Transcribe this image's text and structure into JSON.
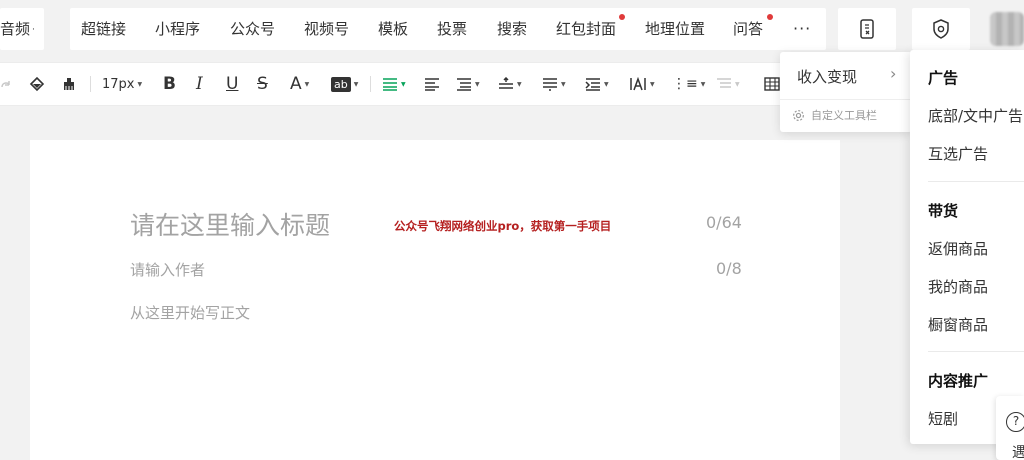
{
  "toolbar_insert": {
    "items": [
      {
        "label": "音频"
      },
      {
        "label": "超链接"
      },
      {
        "label": "小程序"
      },
      {
        "label": "公众号"
      },
      {
        "label": "视频号"
      },
      {
        "label": "模板"
      },
      {
        "label": "投票"
      },
      {
        "label": "搜索"
      },
      {
        "label": "红包封面"
      },
      {
        "label": "地理位置"
      },
      {
        "label": "问答"
      }
    ],
    "more_label": "···",
    "dropdown_glyph": "·"
  },
  "toolbar_format": {
    "font_size": "17px",
    "bold": "B",
    "italic": "I",
    "underline": "U",
    "strike": "S",
    "font_color": "A",
    "bg_color": "ab",
    "list_icon": "⋮≡"
  },
  "editor": {
    "title_placeholder": "请在这里输入标题",
    "title_count": "0/64",
    "author_placeholder": "请输入作者",
    "author_count": "0/8",
    "body_placeholder": "从这里开始写正文",
    "watermark": "公众号飞翔网络创业pro，获取第一手项目"
  },
  "monetize_menu": {
    "label": "收入变现",
    "chevron": "›",
    "customize_label": "自定义工具栏"
  },
  "monetize_submenu": {
    "sections": [
      {
        "header": "广告",
        "items": [
          "底部/文中广告",
          "互选广告"
        ]
      },
      {
        "header": "带货",
        "items": [
          "返佣商品",
          "我的商品",
          "橱窗商品"
        ]
      },
      {
        "header": "内容推广",
        "items": [
          "短剧"
        ]
      }
    ]
  },
  "help": {
    "icon_glyph": "?",
    "label": "遇"
  },
  "colors": {
    "accent_green": "#07a35a",
    "badge_red": "#e03a3a",
    "watermark_red": "#b52020"
  }
}
